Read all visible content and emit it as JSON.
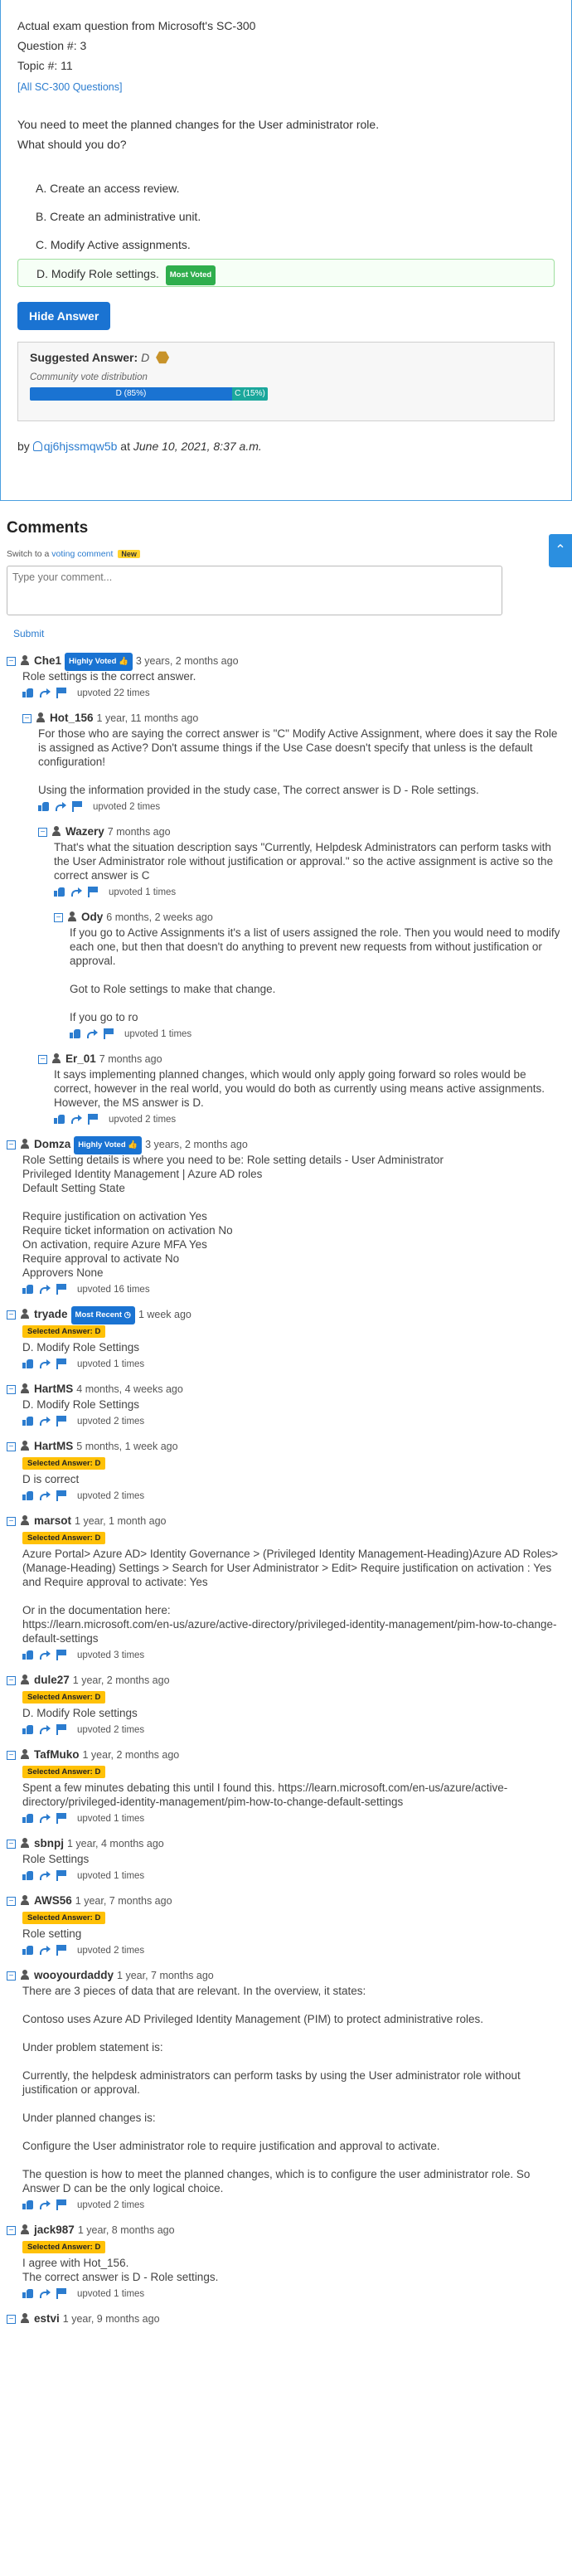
{
  "question": {
    "title": "Actual exam question from Microsoft's SC-300",
    "question_no": "Question #: 3",
    "topic_no": "Topic #: 11",
    "all_link": "[All SC-300 Questions]",
    "body_line1": "You need to meet the planned changes for the User administrator role.",
    "body_line2": "What should you do?",
    "choices": [
      {
        "label": "A. Create an access review."
      },
      {
        "label": "B. Create an administrative unit."
      },
      {
        "label": "C. Modify Active assignments."
      },
      {
        "label": "D. Modify Role settings.",
        "badge": "Most Voted"
      }
    ],
    "hide_answer_button": "Hide Answer",
    "suggested_label": "Suggested Answer:",
    "suggested_value": "D",
    "community_label": "Community vote distribution",
    "vote_a": "D (85%)",
    "vote_b": "C (15%)",
    "vote_a_pct": 85,
    "vote_b_pct": 15,
    "by_prefix": "by",
    "author": "qj6hjssmqw5b",
    "at": "at",
    "date": "June 10, 2021, 8:37 a.m."
  },
  "comments_section": {
    "title": "Comments",
    "switch_prefix": "Switch to a",
    "switch_link": "voting comment",
    "new_badge": "New",
    "placeholder": "Type your comment...",
    "submit": "Submit",
    "scroll_icon": "chevron-up-icon"
  },
  "comments": [
    {
      "level": 0,
      "user": "Che1",
      "badge": "Highly Voted",
      "time": "3 years, 2 months ago",
      "paras": [
        "Role settings is the correct answer."
      ],
      "upvoted": "upvoted 22 times"
    },
    {
      "level": 1,
      "user": "Hot_156",
      "time": "1 year, 11 months ago",
      "paras": [
        "For those who are saying the correct answer is \"C\" Modify Active Assignment, where does it say the Role is assigned as Active? Don't assume things if the Use Case doesn't specify that unless is the default configuration!",
        "Using the information provided in the study case, The correct answer is D - Role settings."
      ],
      "upvoted": "upvoted 2 times"
    },
    {
      "level": 2,
      "user": "Wazery",
      "time": "7 months ago",
      "paras": [
        "That's what the situation description says \"Currently, Helpdesk Administrators can perform tasks with the User Administrator role without justification or approval.\" so the active assignment is active so the correct answer is C"
      ],
      "upvoted": "upvoted 1 times"
    },
    {
      "level": 3,
      "user": "Ody",
      "time": "6 months, 2 weeks ago",
      "paras": [
        "If you go to Active Assignments it's a list of users assigned the role. Then you would need to modify each one, but then that doesn't do anything to prevent new requests from without justification or approval.",
        "Got to Role settings to make that change.",
        "If you go to ro"
      ],
      "upvoted": "upvoted 1 times"
    },
    {
      "level": 2,
      "user": "Er_01",
      "time": "7 months ago",
      "paras": [
        "It says implementing planned changes, which would only apply going forward so roles would be correct, however in the real world, you would do both as currently using means active assignments. However, the MS answer is D."
      ],
      "upvoted": "upvoted 2 times"
    },
    {
      "level": 0,
      "user": "Domza",
      "badge": "Highly Voted",
      "time": "3 years, 2 months ago",
      "paras": [
        "Role Setting details is where you need to be: Role setting details - User Administrator\nPrivileged Identity Management | Azure AD roles\nDefault Setting State",
        "Require justification on activation Yes\nRequire ticket information on activation No\nOn activation, require Azure MFA Yes\nRequire approval to activate No\nApprovers None"
      ],
      "upvoted": "upvoted 16 times"
    },
    {
      "level": 0,
      "user": "tryade",
      "badge_recent": "Most Recent",
      "time": "1 week ago",
      "selected": "Selected Answer: D",
      "paras": [
        "D. Modify Role Settings"
      ],
      "upvoted": "upvoted 1 times"
    },
    {
      "level": 0,
      "user": "HartMS",
      "time": "4 months, 4 weeks ago",
      "paras": [
        "D. Modify Role Settings"
      ],
      "upvoted": "upvoted 2 times"
    },
    {
      "level": 0,
      "user": "HartMS",
      "time": "5 months, 1 week ago",
      "selected": "Selected Answer: D",
      "paras": [
        "D is correct"
      ],
      "upvoted": "upvoted 2 times"
    },
    {
      "level": 0,
      "user": "marsot",
      "time": "1 year, 1 month ago",
      "selected": "Selected Answer: D",
      "paras": [
        "Azure Portal> Azure AD> Identity Governance > (Privileged Identity Management-Heading)Azure AD Roles> (Manage-Heading) Settings > Search for User Administrator > Edit> Require justification on activation : Yes and Require approval to activate: Yes",
        "Or in the documentation here:\nhttps://learn.microsoft.com/en-us/azure/active-directory/privileged-identity-management/pim-how-to-change-default-settings"
      ],
      "upvoted": "upvoted 3 times"
    },
    {
      "level": 0,
      "user": "dule27",
      "time": "1 year, 2 months ago",
      "selected": "Selected Answer: D",
      "paras": [
        "D. Modify Role settings"
      ],
      "upvoted": "upvoted 2 times"
    },
    {
      "level": 0,
      "user": "TafMuko",
      "time": "1 year, 2 months ago",
      "selected": "Selected Answer: D",
      "paras": [
        "Spent a few minutes debating this until I found this. https://learn.microsoft.com/en-us/azure/active-directory/privileged-identity-management/pim-how-to-change-default-settings"
      ],
      "upvoted": "upvoted 1 times"
    },
    {
      "level": 0,
      "user": "sbnpj",
      "time": "1 year, 4 months ago",
      "paras": [
        "Role Settings"
      ],
      "upvoted": "upvoted 1 times"
    },
    {
      "level": 0,
      "user": "AWS56",
      "time": "1 year, 7 months ago",
      "selected": "Selected Answer: D",
      "paras": [
        "Role setting"
      ],
      "upvoted": "upvoted 2 times"
    },
    {
      "level": 0,
      "user": "wooyourdaddy",
      "time": "1 year, 7 months ago",
      "paras": [
        "There are 3 pieces of data that are relevant. In the overview, it states:",
        "Contoso uses Azure AD Privileged Identity Management (PIM) to protect administrative roles.",
        "Under problem statement is:",
        "Currently, the helpdesk administrators can perform tasks by using the User administrator role without justification or approval.",
        "Under planned changes is:",
        "Configure the User administrator role to require justification and approval to activate.",
        "The question is how to meet the planned changes, which is to configure the user administrator role. So Answer D can be the only logical choice."
      ],
      "upvoted": "upvoted 2 times"
    },
    {
      "level": 0,
      "user": "jack987",
      "time": "1 year, 8 months ago",
      "selected": "Selected Answer: D",
      "paras": [
        "I agree with Hot_156.\nThe correct answer is D - Role settings."
      ],
      "upvoted": "upvoted 1 times"
    },
    {
      "level": 0,
      "user": "estvi",
      "time": "1 year, 9 months ago",
      "paras": [],
      "upvoted": ""
    }
  ]
}
